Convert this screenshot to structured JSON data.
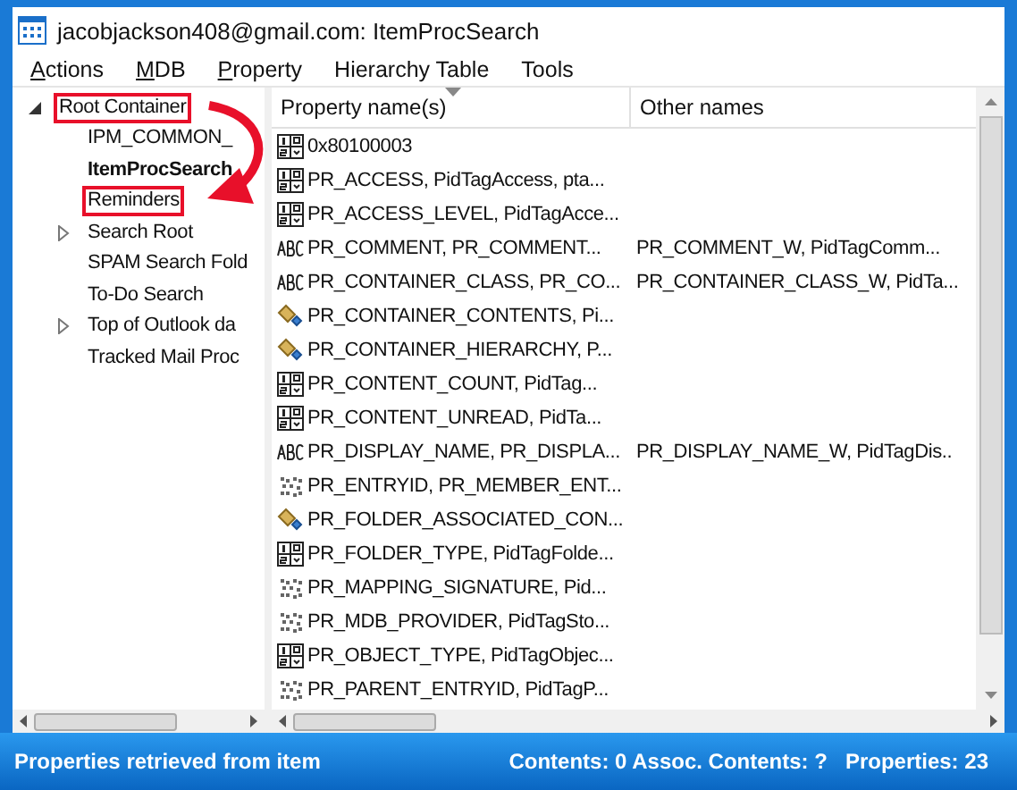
{
  "window": {
    "title": "jacobjackson408@gmail.com: ItemProcSearch"
  },
  "menu": [
    {
      "label": "Actions",
      "underline_first": true
    },
    {
      "label": "MDB",
      "underline_first": true
    },
    {
      "label": "Property",
      "underline_first": true
    },
    {
      "label": "Hierarchy Table",
      "underline_first": false
    },
    {
      "label": "Tools",
      "underline_first": false
    }
  ],
  "tree": [
    {
      "label": "Root Container",
      "expanded": true,
      "selected": false,
      "highlighted": true,
      "children": [
        {
          "label": "IPM_COMMON_",
          "selected": false,
          "highlighted": false
        },
        {
          "label": "ItemProcSearch",
          "selected": true,
          "highlighted": false
        },
        {
          "label": "Reminders",
          "selected": false,
          "highlighted": true
        },
        {
          "label": "Search Root",
          "expanded": false,
          "selected": false,
          "highlighted": false
        },
        {
          "label": "SPAM Search Fold",
          "selected": false,
          "highlighted": false
        },
        {
          "label": "To-Do Search",
          "selected": false,
          "highlighted": false
        },
        {
          "label": "Top of Outlook da",
          "expanded": false,
          "selected": false,
          "highlighted": false
        },
        {
          "label": "Tracked Mail Proc",
          "selected": false,
          "highlighted": false
        }
      ]
    }
  ],
  "table": {
    "columns": [
      "Property name(s)",
      "Other names"
    ],
    "rows": [
      {
        "kind": "number",
        "name": "0x80100003"
      },
      {
        "kind": "number",
        "name": "PR_ACCESS, PidTagAccess, pta..."
      },
      {
        "kind": "number",
        "name": "PR_ACCESS_LEVEL, PidTagAcce..."
      },
      {
        "kind": "string",
        "name": "PR_COMMENT, PR_COMMENT...",
        "other": "PR_COMMENT_W, PidTagComm..."
      },
      {
        "kind": "string",
        "name": "PR_CONTAINER_CLASS, PR_CO...",
        "other": "PR_CONTAINER_CLASS_W, PidTa..."
      },
      {
        "kind": "object",
        "name": "PR_CONTAINER_CONTENTS, Pi..."
      },
      {
        "kind": "object",
        "name": "PR_CONTAINER_HIERARCHY, P..."
      },
      {
        "kind": "number",
        "name": "PR_CONTENT_COUNT, PidTag..."
      },
      {
        "kind": "number",
        "name": "PR_CONTENT_UNREAD, PidTa..."
      },
      {
        "kind": "string",
        "name": "PR_DISPLAY_NAME, PR_DISPLA...",
        "other": "PR_DISPLAY_NAME_W, PidTagDis.."
      },
      {
        "kind": "binary",
        "name": "PR_ENTRYID, PR_MEMBER_ENT..."
      },
      {
        "kind": "object",
        "name": "PR_FOLDER_ASSOCIATED_CON..."
      },
      {
        "kind": "number",
        "name": "PR_FOLDER_TYPE, PidTagFolde..."
      },
      {
        "kind": "binary",
        "name": "PR_MAPPING_SIGNATURE, Pid..."
      },
      {
        "kind": "binary",
        "name": "PR_MDB_PROVIDER, PidTagSto..."
      },
      {
        "kind": "number",
        "name": "PR_OBJECT_TYPE, PidTagObjec..."
      },
      {
        "kind": "binary",
        "name": "PR_PARENT_ENTRYID, PidTagP..."
      }
    ]
  },
  "status_bar": {
    "message": "Properties retrieved from item",
    "contents": "Contents: 0 Assoc. Contents: ?",
    "properties": "Properties: 23"
  }
}
